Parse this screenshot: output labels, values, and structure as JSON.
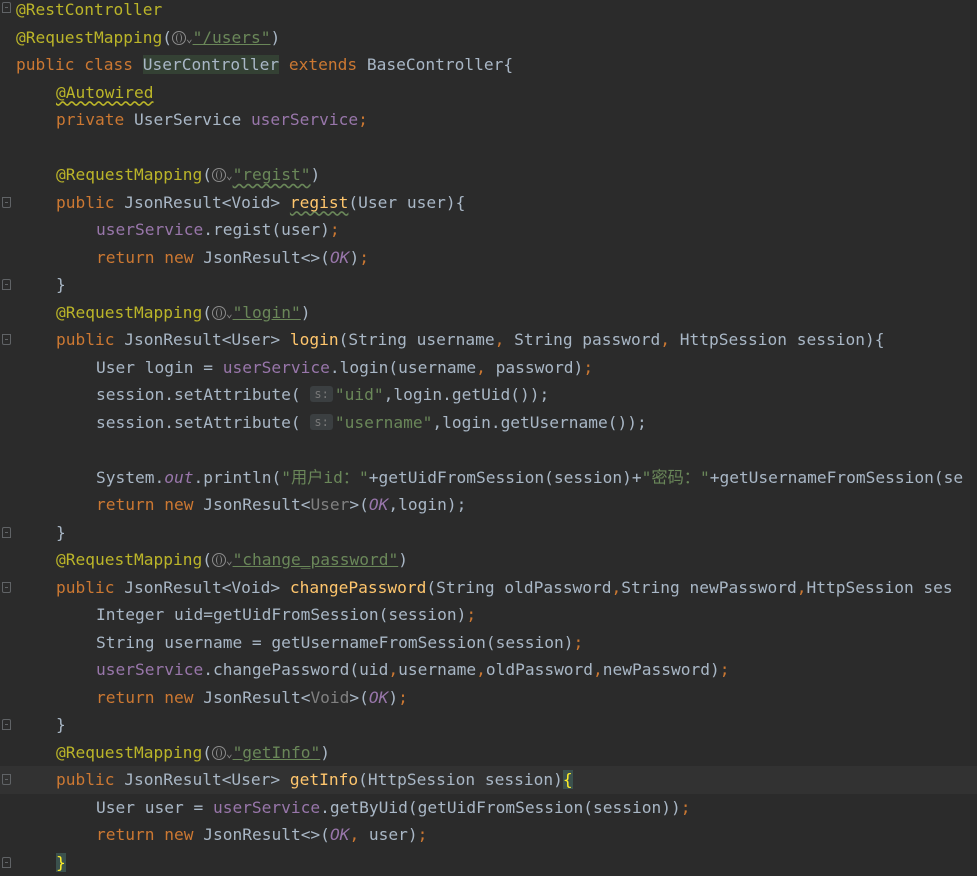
{
  "editor": {
    "class_annotation": "@RestController",
    "mapping_annotation": "@RequestMapping",
    "class_path": "\"/users\"",
    "class_decl": {
      "kw1": "public",
      "kw2": "class",
      "name": "UserController",
      "kw3": "extends",
      "parent": "BaseController{"
    },
    "autowired": "@Autowired",
    "field_decl": {
      "kw": "private",
      "type": "UserService",
      "name": "userService",
      "semi": ";"
    },
    "regist": {
      "path": "\"regist\"",
      "sig_pre": "JsonResult<Void> ",
      "name": "regist",
      "params": "(User user){",
      "call_obj": "userService",
      "call": ".regist(user)",
      "return_kw": "return",
      "new_kw": "new",
      "ret_type": "JsonResult<>(",
      "ok": "OK",
      "ret_end": ");"
    },
    "login": {
      "path": "\"login\"",
      "sig_pre": "JsonResult<User> ",
      "name": "login",
      "p1": "(String username",
      "p2": " String password",
      "p3": " HttpSession session){",
      "l1_pre": "User login = ",
      "l1_obj": "userService",
      "l1_call": ".login(username",
      "l1_arg": " password)",
      "set1_pre": "session.setAttribute(",
      "hint": "s:",
      "set1_str": "\"uid\"",
      "set1_post": ",login.getUid());",
      "set2_str": "\"username\"",
      "set2_post": ",login.getUsername());",
      "print_pre": "System.",
      "print_out": "out",
      "print_call": ".println(",
      "print_s1": "\"用户id：\"",
      "print_mid": "+getUidFromSession(session)+",
      "print_s2": "\"密码：\"",
      "print_end": "+getUsernameFromSession(se",
      "ret_type": "JsonResult<",
      "ret_gen": "User",
      "ret_post": ">(",
      "ret_arg": ",login);"
    },
    "change": {
      "path": "\"change_password\"",
      "sig_pre": "JsonResult<Void> ",
      "name": "changePassword",
      "p1": "(String oldPassword",
      "p2": "String newPassword",
      "p3": "HttpSession ses",
      "l1": "Integer uid=getUidFromSession(session)",
      "l2": "String username = getUsernameFromSession(session)",
      "l3_obj": "userService",
      "l3_call": ".changePassword(uid",
      "l3_a2": "username",
      "l3_a3": "oldPassword",
      "l3_a4": "newPassword)",
      "ret_type": "JsonResult<",
      "ret_gen": "Void",
      "ret_post": ">("
    },
    "getinfo": {
      "path": "\"getInfo\"",
      "sig_pre": "JsonResult<User> ",
      "name": "getInfo",
      "params": "(HttpSession session)",
      "open_brace": "{",
      "l1_pre": "User user = ",
      "l1_obj": "userService",
      "l1_call": ".getByUid(getUidFromSession(session))",
      "ret_type": "JsonResult<>(",
      "ret_arg": " user)",
      "close_brace": "}"
    },
    "close_brace": "}",
    "open_paren": "(",
    "close_paren": ")",
    "semi": ";",
    "comma": ","
  },
  "colors": {
    "background": "#2b2b2b",
    "keyword": "#cc7832",
    "annotation": "#bbb529",
    "string": "#6a8759",
    "field": "#9876aa",
    "function": "#ffc66d",
    "plain": "#a9b7c6"
  }
}
